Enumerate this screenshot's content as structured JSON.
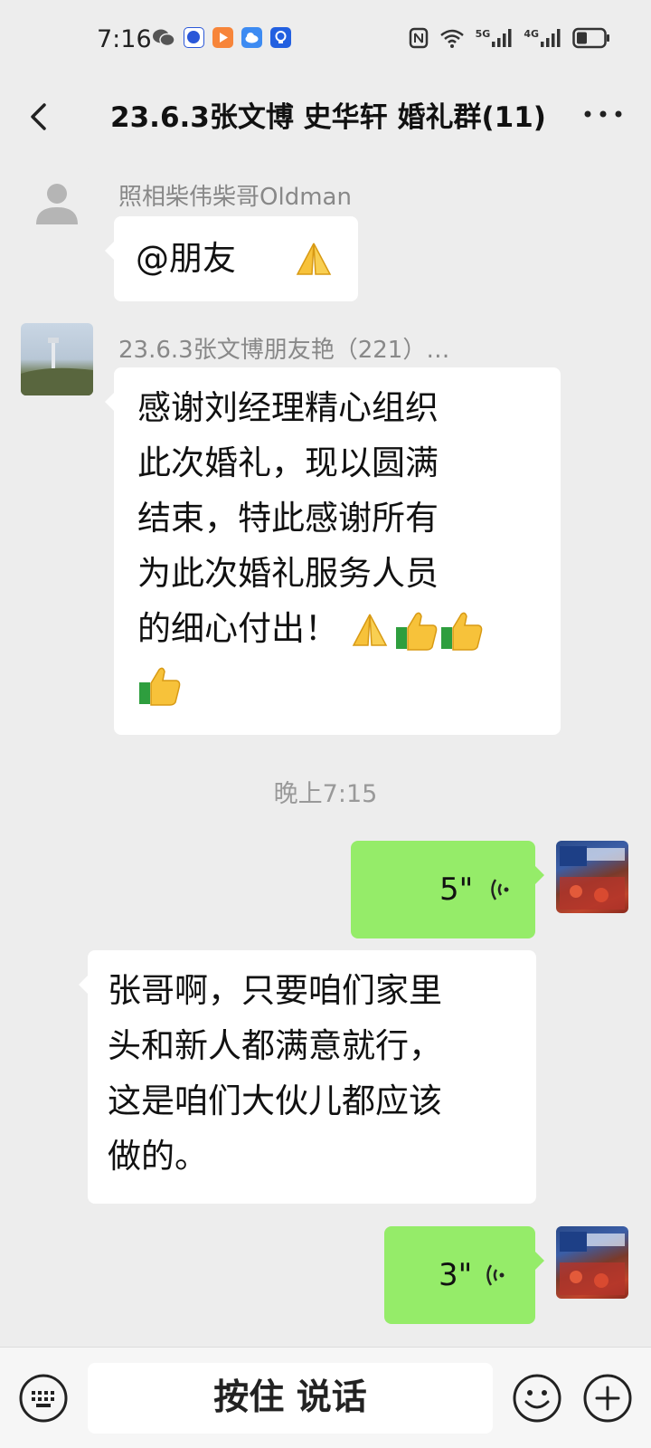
{
  "status_bar": {
    "time": "7:16",
    "app_icons": [
      "wechat-icon",
      "baidu-icon",
      "video-app-icon",
      "cloud-app-icon",
      "bulb-app-icon"
    ],
    "system_icons": [
      "nfc-icon",
      "wifi-icon",
      "signal-5g-icon",
      "signal-4g-icon",
      "battery-icon"
    ],
    "network_1": "5G",
    "network_2": "4G"
  },
  "header": {
    "title": "23.6.3张文博 史华轩 婚礼群(11)",
    "back_icon": "chevron-left-icon",
    "more_icon": "more-icon"
  },
  "messages": [
    {
      "sender": "照相柴伟柴哥Oldman",
      "text": "@朋友",
      "emojis": [
        "folded-hands"
      ],
      "side": "left"
    },
    {
      "sender": "23.6.3张文博朋友艳（221）…",
      "lines": [
        "感谢刘经理精心组织",
        "此次婚礼，现以圆满",
        "结束，特此感谢所有",
        "为此次婚礼服务人员",
        "的细心付出！"
      ],
      "emojis": [
        "folded-hands",
        "thumbs-up",
        "thumbs-up",
        "thumbs-up"
      ],
      "side": "left"
    }
  ],
  "timestamp": "晚上7:15",
  "voice_messages": [
    {
      "duration": "5\"",
      "side": "right"
    },
    {
      "duration": "3\"",
      "side": "right"
    }
  ],
  "reply": {
    "lines": [
      "张哥啊，只要咱们家里",
      "头和新人都满意就行，",
      "这是咱们大伙儿都应该",
      "做的。"
    ],
    "side": "left"
  },
  "input_bar": {
    "hold_to_talk": "按住 说话",
    "keyboard_icon": "keyboard-icon",
    "emoji_icon": "smiley-icon",
    "plus_icon": "plus-icon"
  },
  "colors": {
    "background": "#ededed",
    "bubble_self": "#95ec69",
    "bubble_other": "#ffffff"
  }
}
